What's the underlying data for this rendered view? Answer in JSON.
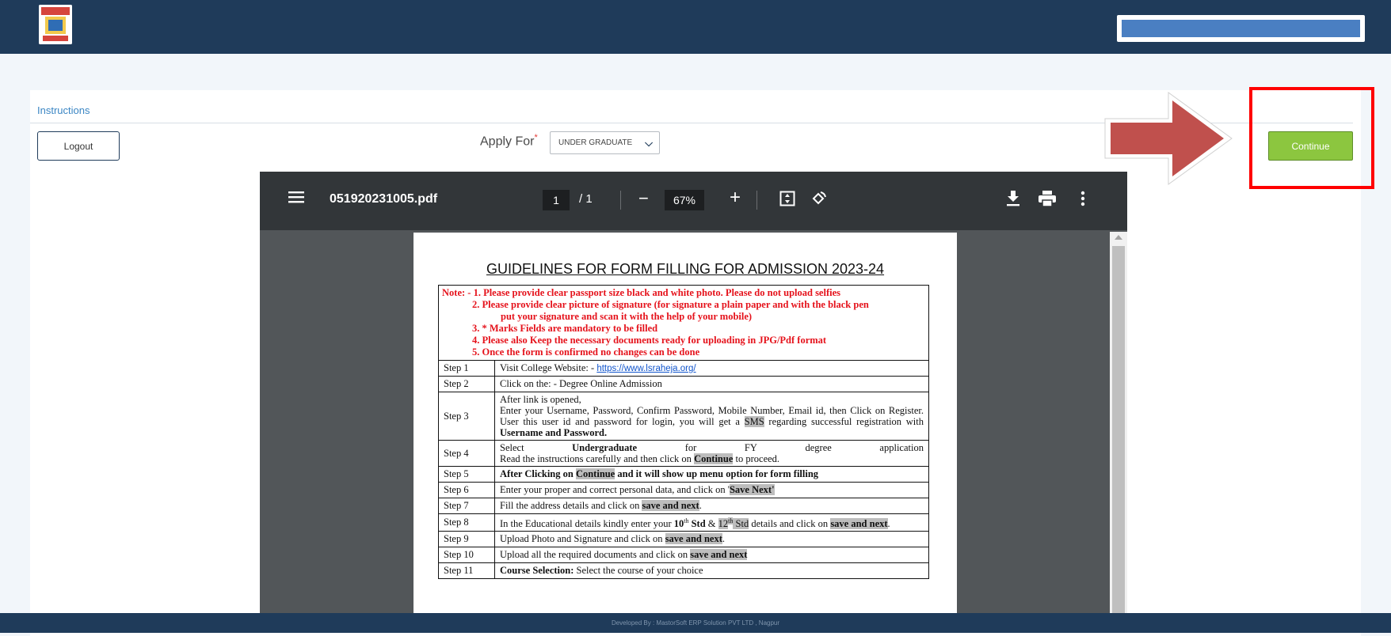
{
  "header": {
    "logo": "college-logo"
  },
  "nav": {
    "tab_label": "Instructions"
  },
  "toolbar": {
    "logout_label": "Logout",
    "apply_for_label": "Apply For",
    "apply_for_required_mark": "*",
    "apply_for_value": "UNDER GRADUATE",
    "continue_label": "Continue"
  },
  "pdf": {
    "file_name": "051920231005.pdf",
    "current_page": "1",
    "total_pages": "/ 1",
    "zoom": "67%",
    "icons": [
      "menu-icon",
      "zoom-out-icon",
      "zoom-in-icon",
      "fit-page-icon",
      "rotate-icon",
      "download-icon",
      "print-icon",
      "more-icon"
    ]
  },
  "document": {
    "title": "GUIDELINES FOR FORM FILLING FOR ADMISSION 2023-24",
    "notes": [
      "Note: - 1. Please provide clear passport size black and white photo. Please do not upload selfies",
      "2. Please provide clear picture of signature (for signature a plain paper and with the black pen",
      "put your signature and scan it with the help of your mobile)",
      "3. * Marks Fields are mandatory to be filled",
      "4. Please also Keep the necessary documents ready for uploading in JPG/Pdf format",
      "5. Once the form is confirmed no changes can be done"
    ],
    "steps": [
      {
        "step": "Step 1",
        "text": "Visit College Website: - ",
        "link": "https://www.lsraheja.org/"
      },
      {
        "step": "Step 2",
        "text": "Click on the: - Degree Online Admission"
      },
      {
        "step": "Step 3",
        "text_a": "After link is opened,",
        "text_b": "Enter your Username, Password, Confirm Password, Mobile Number, Email id, then Click on Register. User this user id and password for login, you will get a ",
        "hl_sms": "SMS",
        "text_c": " regarding successful registration with ",
        "bold": "Username and Password."
      },
      {
        "step": "Step 4",
        "w1": "Select",
        "w2": "Undergraduate",
        "w3": "for",
        "w4": "FY",
        "w5": "degree",
        "w6": "application",
        "text_b": "Read the instructions carefully and then click on ",
        "hl": "Continue",
        "text_c": " to proceed."
      },
      {
        "step": "Step 5",
        "text_a": "After Clicking on ",
        "hl": "Continue",
        "text_b": " and it will show up menu option for form filling"
      },
      {
        "step": "Step 6",
        "text_a": "Enter your proper and correct personal data, and click on '",
        "hl": "Save Next'",
        "text_b": ""
      },
      {
        "step": "Step 7",
        "text_a": "Fill the address details and click on ",
        "hl": "save and next",
        "text_b": "."
      },
      {
        "step": "Step 8",
        "text_a": "In the Educational details kindly enter your ",
        "b1": "10",
        "sup1": "th",
        "b2": " Std",
        "amp": " & ",
        "hl_a": "12",
        "sup2": "th",
        "hl_b": " Std",
        "text_b": " details and click on ",
        "hl": "save and next",
        "text_c": "."
      },
      {
        "step": "Step 9",
        "text_a": "Upload Photo and Signature and click on ",
        "hl": "save and next",
        "text_b": "."
      },
      {
        "step": "Step 10",
        "text_a": "Upload all the required documents and click on ",
        "hl": "save and next"
      },
      {
        "step": "Step 11",
        "bold": "Course Selection:",
        "text_a": " Select the course of your choice"
      }
    ]
  },
  "footer": {
    "text": "Developed By : MastorSoft ERP Solution PVT LTD , Nagpur"
  },
  "colors": {
    "header_bg": "#1f3b5a",
    "continue_bg": "#8cc63f",
    "highlight_border": "#ff0000",
    "arrow": "#c0504d"
  }
}
